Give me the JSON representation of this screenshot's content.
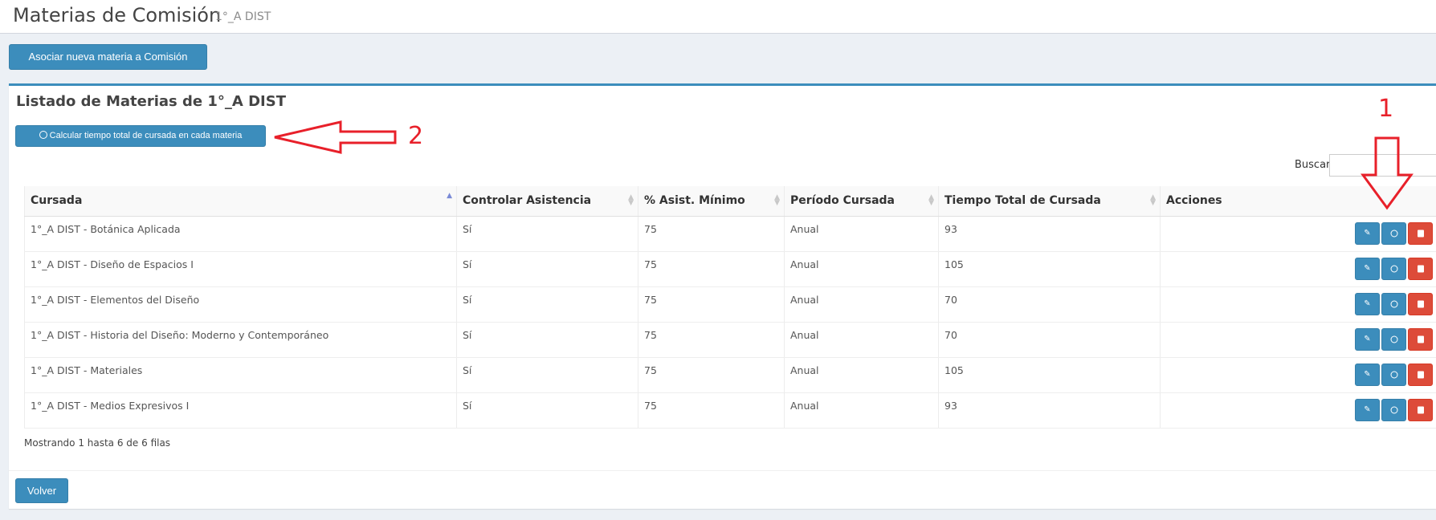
{
  "header": {
    "title": "Materias de Comisión",
    "subtitle": "1°_A DIST"
  },
  "toolbar": {
    "assoc_label": "Asociar nueva materia a Comisión"
  },
  "box": {
    "title": "Listado de Materias de 1°_A DIST",
    "calc_label": "Calcular tiempo total de cursada en cada materia",
    "search_label": "Buscar:",
    "search_value": ""
  },
  "table": {
    "columns": [
      "Cursada",
      "Controlar Asistencia",
      "% Asist. Mínimo",
      "Período Cursada",
      "Tiempo Total de Cursada",
      "Acciones"
    ],
    "rows": [
      [
        "1°_A DIST - Botánica Aplicada",
        "Sí",
        "75",
        "Anual",
        "93"
      ],
      [
        "1°_A DIST - Diseño de Espacios I",
        "Sí",
        "75",
        "Anual",
        "105"
      ],
      [
        "1°_A DIST - Elementos del Diseño",
        "Sí",
        "75",
        "Anual",
        "70"
      ],
      [
        "1°_A DIST - Historia del Diseño: Moderno y Contemporáneo",
        "Sí",
        "75",
        "Anual",
        "70"
      ],
      [
        "1°_A DIST - Materiales",
        "Sí",
        "75",
        "Anual",
        "105"
      ],
      [
        "1°_A DIST - Medios Expresivos I",
        "Sí",
        "75",
        "Anual",
        "93"
      ]
    ],
    "footer": "Mostrando 1 hasta 6 de 6 filas"
  },
  "back_label": "Volver",
  "annotations": {
    "one": "1",
    "two": "2"
  },
  "icons": {
    "edit": "pencil-square-icon",
    "time": "clock-icon",
    "delete": "trash-icon",
    "calc": "clock-icon"
  },
  "colors": {
    "primary": "#3c8dbc",
    "danger": "#dd4b39",
    "annotation": "#e8202a"
  }
}
